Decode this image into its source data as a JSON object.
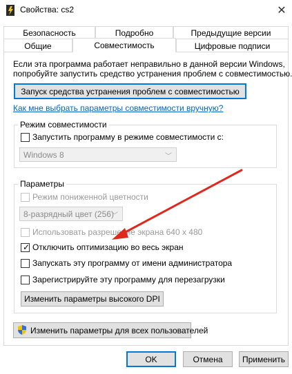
{
  "window": {
    "title": "Свойства: cs2",
    "close": "✕"
  },
  "tabs": {
    "row1": [
      "Безопасность",
      "Подробно",
      "Предыдущие версии"
    ],
    "row2": [
      "Общие",
      "Совместимость",
      "Цифровые подписи"
    ],
    "active": "Совместимость"
  },
  "intro": {
    "line1": "Если эта программа работает неправильно в данной версии Windows,",
    "line2": "попробуйте запустить средство устранения проблем с совместимостью.",
    "troubleshoot_button": "Запуск средства устранения проблем с совместимостью",
    "help_link": "Как мне выбрать параметры совместимости вручную?"
  },
  "compat_mode": {
    "group_title": "Режим совместимости",
    "checkbox_label": "Запустить программу в режиме совместимости с:",
    "checked": false,
    "os_select": "Windows 8"
  },
  "params": {
    "group_title": "Параметры",
    "reduced_color_label": "Режим пониженной цветности",
    "color_select": "8-разрядный цвет (256)",
    "resolution_label": "Использовать разрешение экрана 640 x 480",
    "disable_fullscreen_label": "Отключить оптимизацию во весь экран",
    "disable_fullscreen_checked": true,
    "run_admin_label": "Запускать эту программу от имени администратора",
    "register_restart_label": "Зарегистрируйте эту программу для перезагрузки",
    "high_dpi_button": "Изменить параметры высокого DPI"
  },
  "all_users_button": "Изменить параметры для всех пользователей",
  "footer": {
    "ok": "OK",
    "cancel": "Отмена",
    "apply": "Применить"
  },
  "colors": {
    "accent": "#0078d7",
    "link": "#0066cc",
    "arrow": "#e0271c"
  }
}
